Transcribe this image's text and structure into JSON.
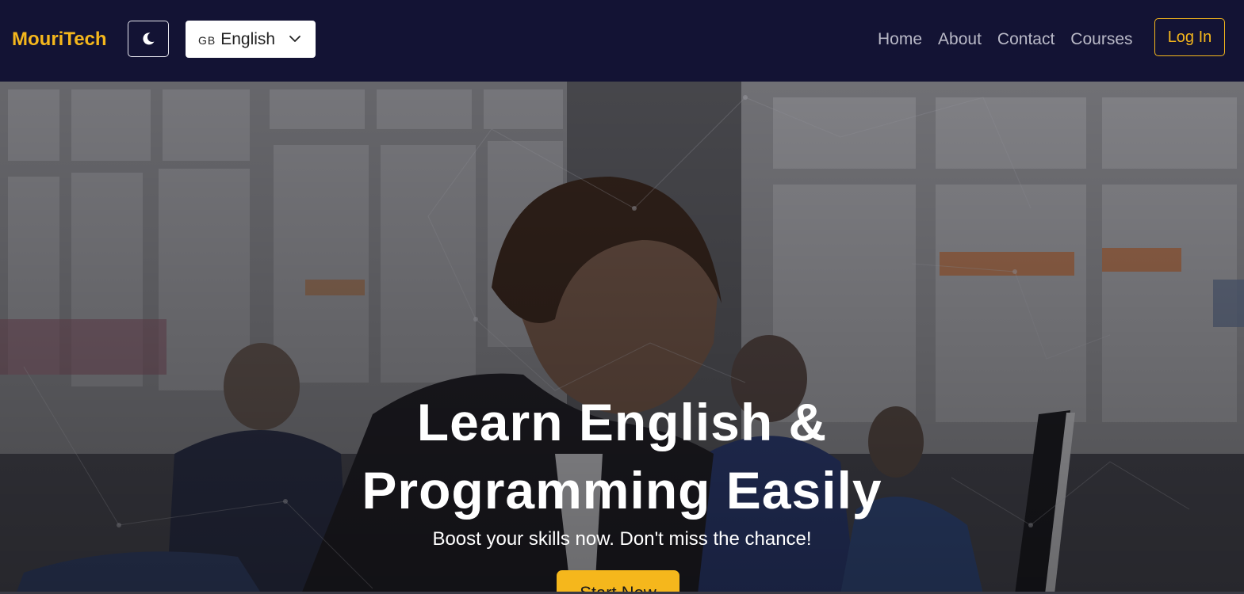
{
  "nav": {
    "brand": "MouriTech",
    "language": {
      "flag": "GB",
      "selected": "English"
    },
    "links": [
      "Home",
      "About",
      "Contact",
      "Courses"
    ],
    "login_label": "Log In"
  },
  "hero": {
    "title_line1": "Learn English &",
    "title_line2": "Programming Easily",
    "subtitle": "Boost your skills now. Don't miss the chance!",
    "cta_label": "Start Now"
  },
  "colors": {
    "navbar_bg": "#131334",
    "accent": "#f5b71c",
    "nav_link": "#b9b9c7"
  },
  "icons": {
    "theme_toggle": "moon-icon",
    "language_dropdown": "chevron-down-icon"
  }
}
